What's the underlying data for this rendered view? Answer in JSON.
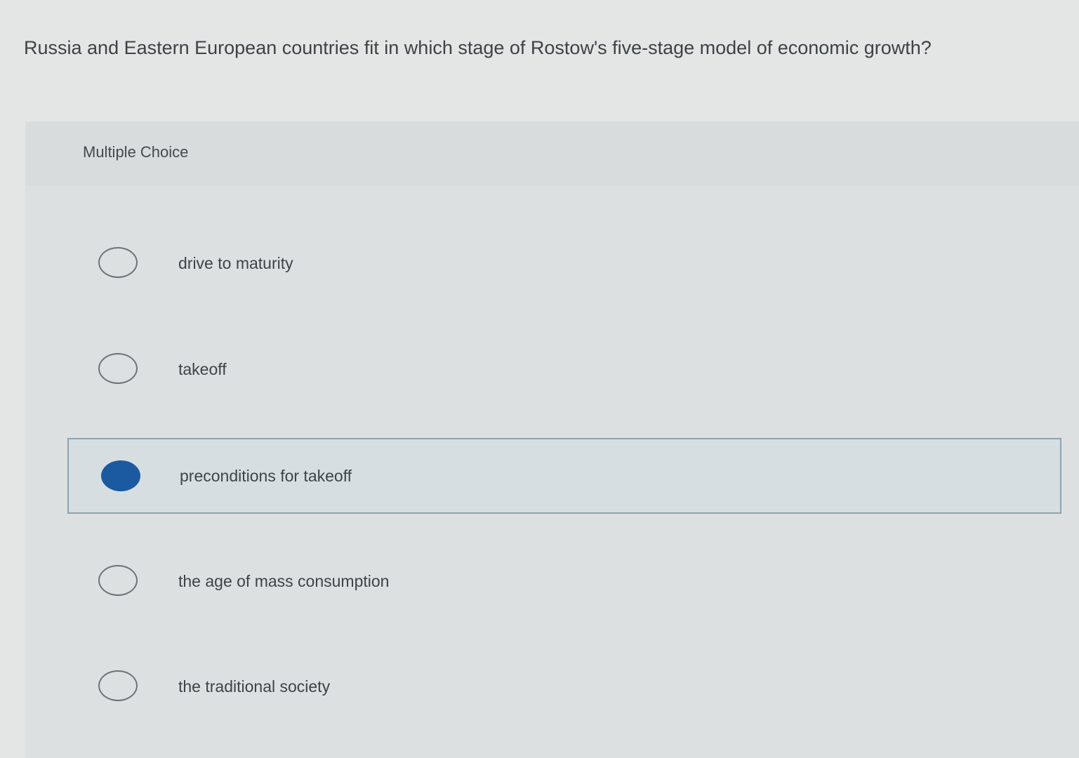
{
  "question": {
    "text": "Russia and Eastern European countries fit in which stage of Rostow's five-stage model of economic growth?"
  },
  "question_type": "Multiple Choice",
  "options": [
    {
      "label": "drive to maturity",
      "selected": false
    },
    {
      "label": "takeoff",
      "selected": false
    },
    {
      "label": "preconditions for takeoff",
      "selected": true
    },
    {
      "label": "the age of mass consumption",
      "selected": false
    },
    {
      "label": "the traditional society",
      "selected": false
    }
  ],
  "colors": {
    "selected_radio": "#1b5aa1",
    "selected_border": "#8fa3ae",
    "background": "#e4e6e6"
  }
}
